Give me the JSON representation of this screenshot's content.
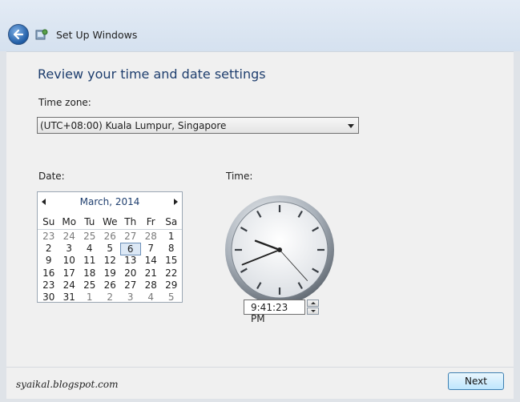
{
  "window": {
    "title": "Set Up Windows"
  },
  "icons": {
    "back": "back-arrow-icon",
    "setup": "setup-windows-icon"
  },
  "main": {
    "heading": "Review your time and date settings",
    "time_zone_label": "Time zone:",
    "time_zone_value": "(UTC+08:00) Kuala Lumpur, Singapore",
    "date_label": "Date:",
    "time_label": "Time:"
  },
  "calendar": {
    "month": "March, 2014",
    "weekdays": [
      "Su",
      "Mo",
      "Tu",
      "We",
      "Th",
      "Fr",
      "Sa"
    ],
    "weeks": [
      [
        "23",
        "24",
        "25",
        "26",
        "27",
        "28",
        "1"
      ],
      [
        "2",
        "3",
        "4",
        "5",
        "6",
        "7",
        "8"
      ],
      [
        "9",
        "10",
        "11",
        "12",
        "13",
        "14",
        "15"
      ],
      [
        "16",
        "17",
        "18",
        "19",
        "20",
        "21",
        "22"
      ],
      [
        "23",
        "24",
        "25",
        "26",
        "27",
        "28",
        "29"
      ],
      [
        "30",
        "31",
        "1",
        "2",
        "3",
        "4",
        "5"
      ]
    ],
    "selected": "6"
  },
  "clock": {
    "time": "9:41:23 PM",
    "hours": 21,
    "minutes": 41,
    "seconds": 23
  },
  "footer": {
    "watermark": "syaikal.blogspot.com",
    "next_label": "Next"
  },
  "colors": {
    "heading": "#1e3e6e",
    "accent": "#3c7fb1"
  }
}
